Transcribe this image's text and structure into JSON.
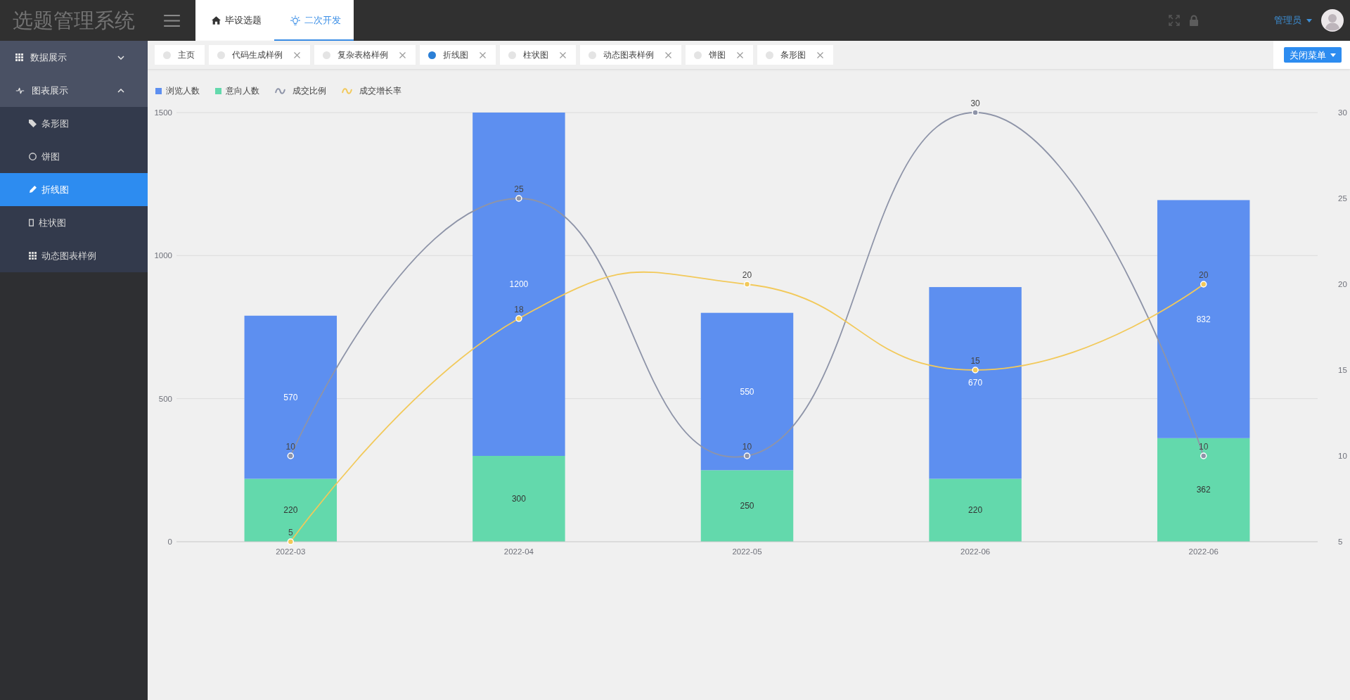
{
  "header": {
    "logo": "选题管理系统",
    "nav_tabs": [
      {
        "label": "毕设选题",
        "selected": false
      },
      {
        "label": "二次开发",
        "selected": true
      }
    ],
    "user": "管理员"
  },
  "sidebar": {
    "items": [
      {
        "label": "数据展示",
        "expanded": false
      },
      {
        "label": "图表展示",
        "expanded": true,
        "children": [
          {
            "label": "条形图",
            "selected": false
          },
          {
            "label": "饼图",
            "selected": false
          },
          {
            "label": "折线图",
            "selected": true
          },
          {
            "label": "柱状图",
            "selected": false
          },
          {
            "label": "动态图表样例",
            "selected": false
          }
        ]
      }
    ]
  },
  "page_tabs": [
    {
      "label": "主页",
      "selected": false,
      "closable": false
    },
    {
      "label": "代码生成样例",
      "selected": false,
      "closable": true
    },
    {
      "label": "复杂表格样例",
      "selected": false,
      "closable": true
    },
    {
      "label": "折线图",
      "selected": true,
      "closable": true
    },
    {
      "label": "柱状图",
      "selected": false,
      "closable": true
    },
    {
      "label": "动态图表样例",
      "selected": false,
      "closable": true
    },
    {
      "label": "饼图",
      "selected": false,
      "closable": true
    },
    {
      "label": "条形图",
      "selected": false,
      "closable": true
    }
  ],
  "close_menu_button": "关闭菜单",
  "bar_chart": {
    "chart_data": {
      "type": "bar",
      "legend": "top-left",
      "categories": [
        "2022-03",
        "2022-04",
        "2022-05",
        "2022-06",
        "2022-06"
      ],
      "stacked": true,
      "data_labels": true,
      "ylim": [
        0,
        1500
      ],
      "yticks": [
        0,
        500,
        1000,
        1500
      ],
      "series": [
        {
          "name": "浏览人数",
          "color": "#5d8ff0",
          "values": [
            570,
            1200,
            550,
            670,
            832
          ]
        },
        {
          "name": "意向人数",
          "color": "#63d9ac",
          "values": [
            220,
            300,
            250,
            220,
            362
          ]
        }
      ]
    }
  },
  "line_chart": {
    "chart_data": {
      "type": "line",
      "legend": "top-left",
      "data_labels": true,
      "ylim": [
        5,
        30
      ],
      "yticks": [
        5,
        10,
        15,
        20,
        25,
        30
      ],
      "series": [
        {
          "name": "成交比例",
          "color": "#8e94a8",
          "marker": "circle",
          "values": [
            10,
            25,
            10,
            30,
            10
          ]
        },
        {
          "name": "成交增长率",
          "color": "#f2c95a",
          "marker": "circle",
          "values": [
            5,
            18,
            20,
            15,
            20
          ]
        }
      ]
    }
  }
}
